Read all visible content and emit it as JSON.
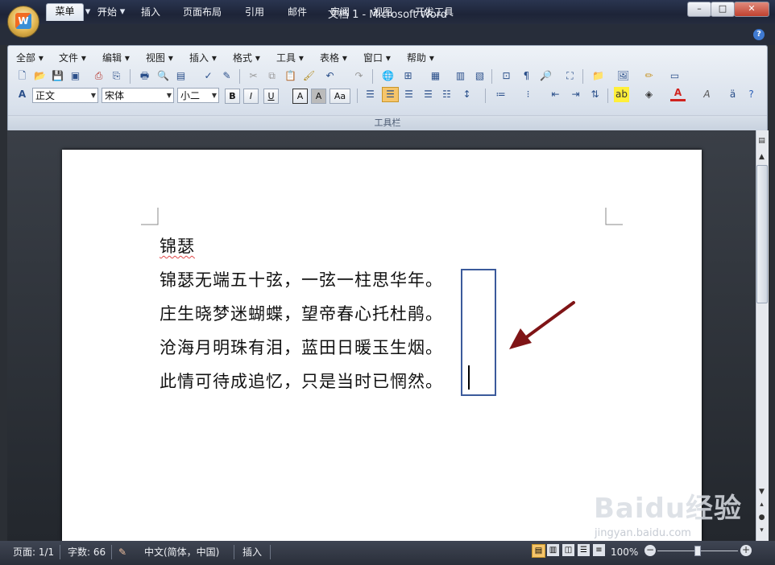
{
  "window": {
    "title": "文档 1 - Microsoft Word",
    "controls": {
      "minimize": "–",
      "maximize": "□",
      "close": "✕"
    }
  },
  "office_button": {
    "logo_text": "W"
  },
  "quick_access": {
    "save_icon": "💾",
    "undo_icon": "↶",
    "redo_icon": "↷",
    "more_icon": "▾"
  },
  "tabs": [
    "菜单",
    "开始",
    "插入",
    "页面布局",
    "引用",
    "邮件",
    "审阅",
    "视图",
    "开发工具"
  ],
  "help_icon": "?",
  "menu_bar": [
    "全部",
    "文件",
    "编辑",
    "视图",
    "插入",
    "格式",
    "工具",
    "表格",
    "窗口",
    "帮助"
  ],
  "format_bar": {
    "style": "正文",
    "font": "宋体",
    "size": "小二",
    "bold": "B",
    "italic": "I",
    "underline": "U",
    "char_border": "A",
    "char_shading": "A",
    "change_case": "Aa"
  },
  "ribbon_group_label": "工具栏",
  "document": {
    "lines": [
      "锦瑟",
      "锦瑟无端五十弦，一弦一柱思华年。",
      "庄生晓梦迷蝴蝶，望帝春心托杜鹃。",
      "沧海月明珠有泪，蓝田日暖玉生烟。",
      "此情可待成追忆，只是当时已惘然。"
    ],
    "annotation_color": "#7f1416",
    "highlight_color": "#3b5a9b"
  },
  "status_bar": {
    "page": "页面: 1/1",
    "words": "字数: 66",
    "language": "中文(简体，中国)",
    "mode": "插入",
    "zoom": "100%"
  },
  "watermark": {
    "text": "Baidu经验",
    "sub": "jingyan.baidu.com"
  }
}
